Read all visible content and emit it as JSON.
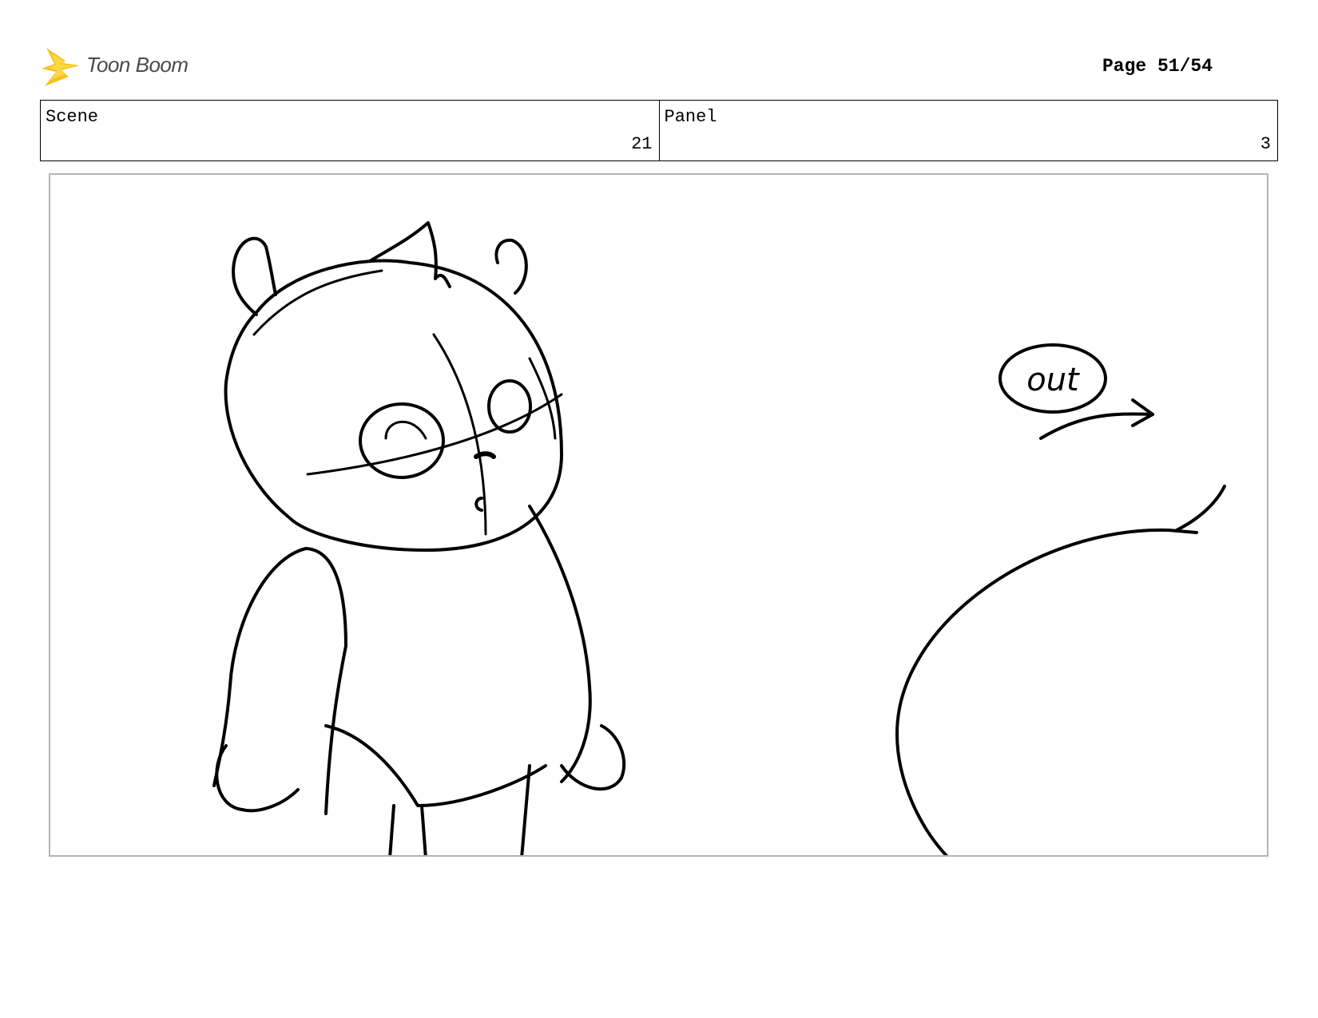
{
  "header": {
    "logo_text": "Toon Boom",
    "page_label": "Page 51/54"
  },
  "info": {
    "scene_label": "Scene",
    "scene_value": "21",
    "panel_label": "Panel",
    "panel_value": "3"
  },
  "panel": {
    "annotation_text": "out",
    "annotation_icon": "right-arrow-icon"
  }
}
